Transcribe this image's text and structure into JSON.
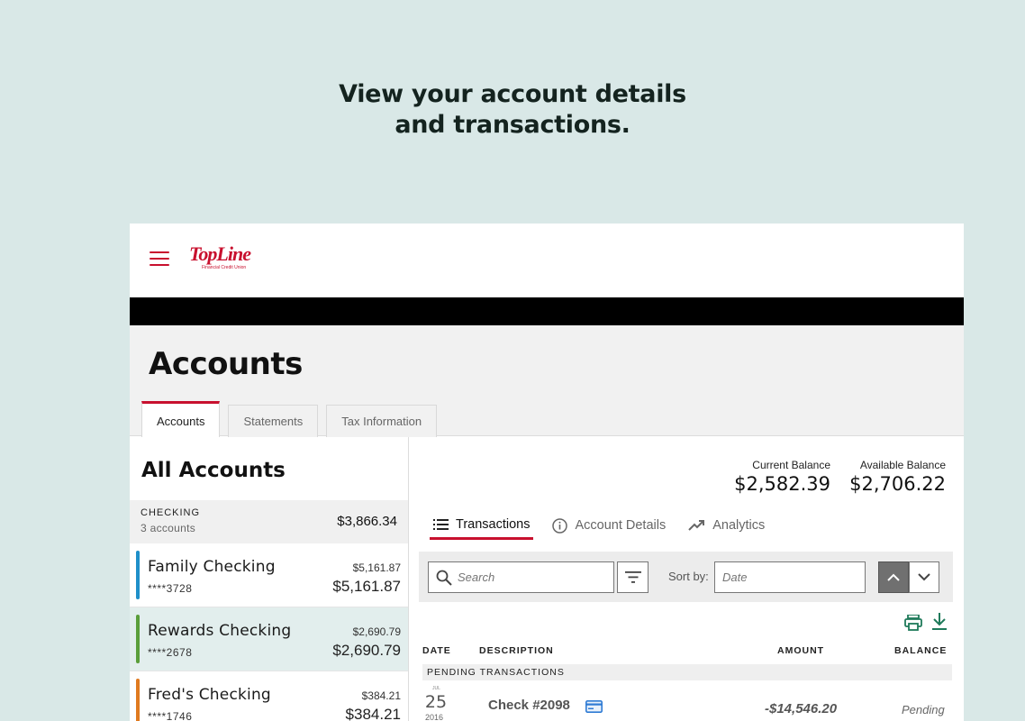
{
  "headline": {
    "line1": "View your account details",
    "line2": "and transactions."
  },
  "logo": {
    "wordmark": "TopLine",
    "sub": "Financial Credit Union"
  },
  "page": {
    "title": "Accounts",
    "tabs": [
      {
        "label": "Accounts",
        "active": true
      },
      {
        "label": "Statements",
        "active": false
      },
      {
        "label": "Tax Information",
        "active": false
      }
    ]
  },
  "sidebar": {
    "heading": "All Accounts",
    "group": {
      "name": "CHECKING",
      "count": "3 accounts",
      "total": "$3,866.34"
    },
    "accounts": [
      {
        "name": "Family Checking",
        "number": "****3728",
        "small_balance": "$5,161.87",
        "balance": "$5,161.87",
        "color": "#1f8fc9"
      },
      {
        "name": "Rewards Checking",
        "number": "****2678",
        "small_balance": "$2,690.79",
        "balance": "$2,690.79",
        "color": "#5a9e3a"
      },
      {
        "name": "Fred's Checking",
        "number": "****1746",
        "small_balance": "$384.21",
        "balance": "$384.21",
        "color": "#e07a1f"
      }
    ]
  },
  "detail": {
    "current_balance": {
      "label": "Current Balance",
      "value": "$2,582.39"
    },
    "available_balance": {
      "label": "Available Balance",
      "value": "$2,706.22"
    },
    "subtabs": [
      {
        "label": "Transactions",
        "icon": "list-icon",
        "active": true
      },
      {
        "label": "Account Details",
        "icon": "info-icon",
        "active": false
      },
      {
        "label": "Analytics",
        "icon": "trending-up-icon",
        "active": false
      }
    ],
    "search_placeholder": "Search",
    "sort_label": "Sort by:",
    "sort_placeholder": "Date",
    "columns": {
      "date": "DATE",
      "description": "DESCRIPTION",
      "amount": "AMOUNT",
      "balance": "BALANCE"
    },
    "pending_header": "PENDING TRANSACTIONS",
    "transactions": [
      {
        "month": "JUL",
        "day": "25",
        "year": "2016",
        "description": "Check #2098",
        "amount": "-$14,546.20",
        "balance": "Pending"
      }
    ]
  },
  "colors": {
    "accent": "#c8102e",
    "page_bg": "#d9e8e7",
    "selected_row": "#e2eeed",
    "icon_green": "#1f7a5a"
  }
}
